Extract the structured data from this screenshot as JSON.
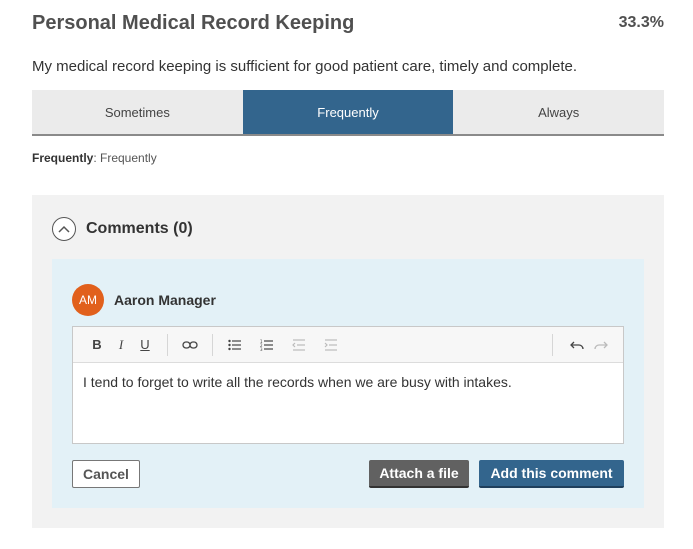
{
  "header": {
    "title": "Personal Medical Record Keeping",
    "score": "33.3%"
  },
  "question": "My medical record keeping is sufficient for good patient care, timely and complete.",
  "options": [
    {
      "label": "Sometimes",
      "selected": false
    },
    {
      "label": "Frequently",
      "selected": true
    },
    {
      "label": "Always",
      "selected": false
    }
  ],
  "selected_summary": {
    "label": "Frequently",
    "value": ": Frequently"
  },
  "comments": {
    "title": "Comments (0)",
    "toggle_icon": "chevron-up-circle-icon",
    "author": {
      "initials": "AM",
      "name": "Aaron Manager",
      "avatar_color": "#e1601c"
    },
    "toolbar": {
      "bold": "B",
      "italic": "I",
      "underline": "U"
    },
    "draft_text": "I tend to forget to write all the records when we are busy with intakes.",
    "cancel_label": "Cancel",
    "attach_label": "Attach a file",
    "add_label": "Add this comment"
  },
  "colors": {
    "primary": "#33658d",
    "panel": "#f2f2f2",
    "comment_bg": "#e3f1f7",
    "attach": "#616161"
  }
}
